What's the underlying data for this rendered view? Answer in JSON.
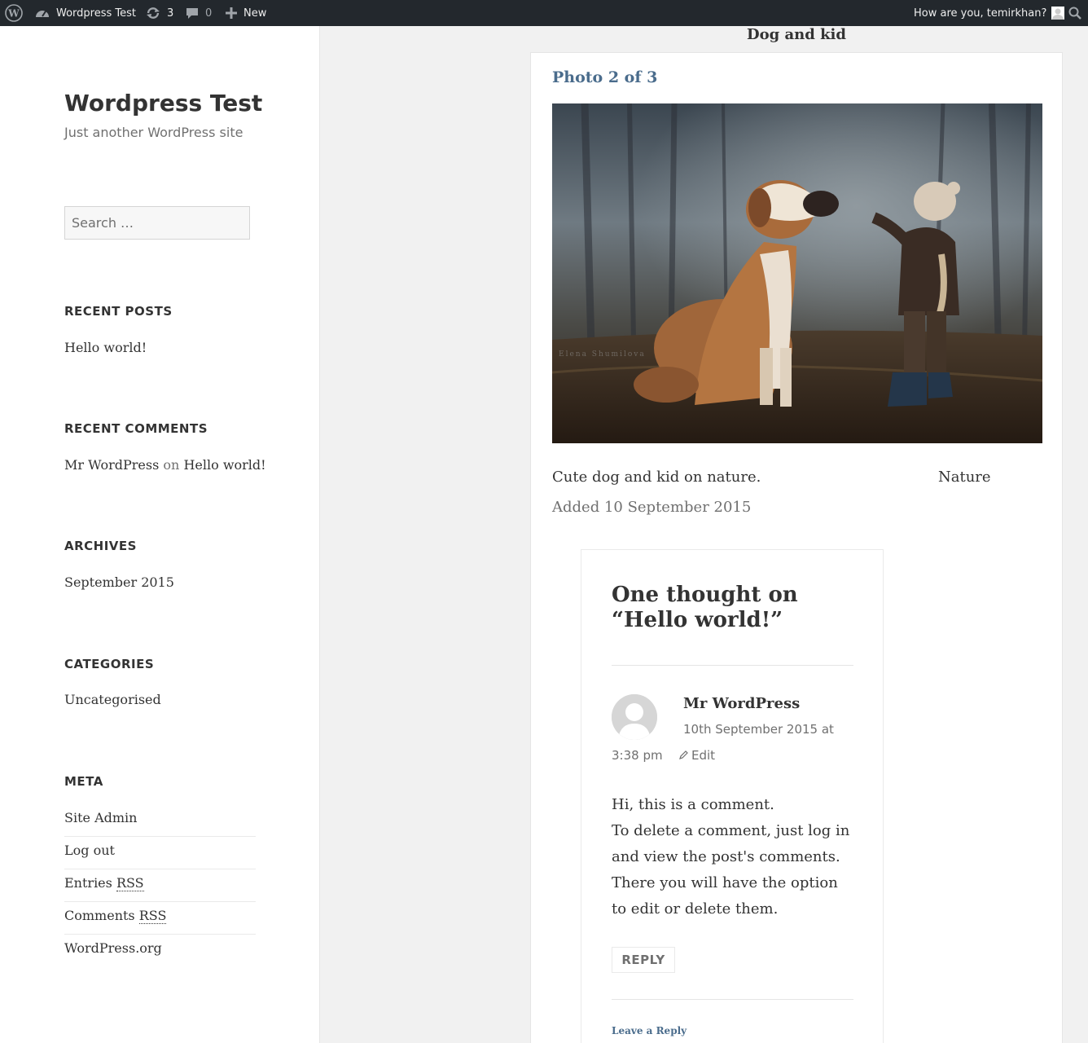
{
  "adminbar": {
    "site_name": "Wordpress Test",
    "updates_count": "3",
    "comments_count": "0",
    "new_label": "New",
    "greeting": "How are you, temirkhan?"
  },
  "sidebar": {
    "site_title": "Wordpress Test",
    "site_description": "Just another WordPress site",
    "search_placeholder": "Search …",
    "recent_posts": {
      "title": "RECENT POSTS",
      "items": [
        "Hello world!"
      ]
    },
    "recent_comments": {
      "title": "RECENT COMMENTS",
      "author": "Mr WordPress",
      "on": "on",
      "post": "Hello world!"
    },
    "archives": {
      "title": "ARCHIVES",
      "items": [
        "September 2015"
      ]
    },
    "categories": {
      "title": "CATEGORIES",
      "items": [
        "Uncategorised"
      ]
    },
    "meta": {
      "title": "META",
      "site_admin": "Site Admin",
      "log_out": "Log out",
      "entries_prefix": "Entries ",
      "comments_prefix": "Comments ",
      "rss": "RSS",
      "wordpress_org": "WordPress.org"
    }
  },
  "post": {
    "heading": "Dog and kid",
    "photo_count": "Photo 2 of 3",
    "caption": "Cute dog and kid on nature.",
    "category": "Nature",
    "added": "Added 10 September 2015",
    "photo_watermark": "Elena Shumilova"
  },
  "comments": {
    "title_line1": "One thought on",
    "title_line2": "“Hello world!”",
    "author": "Mr WordPress",
    "date": "10th September 2015 at",
    "time": "3:38 pm",
    "edit": "Edit",
    "body_line1": "Hi, this is a comment.",
    "body_line2": "To delete a comment, just log in",
    "body_line3": "and view the post's comments.",
    "body_line4": "There you will have the option",
    "body_line5": "to edit or delete them.",
    "reply": "REPLY",
    "leave_reply": "Leave a Reply"
  }
}
